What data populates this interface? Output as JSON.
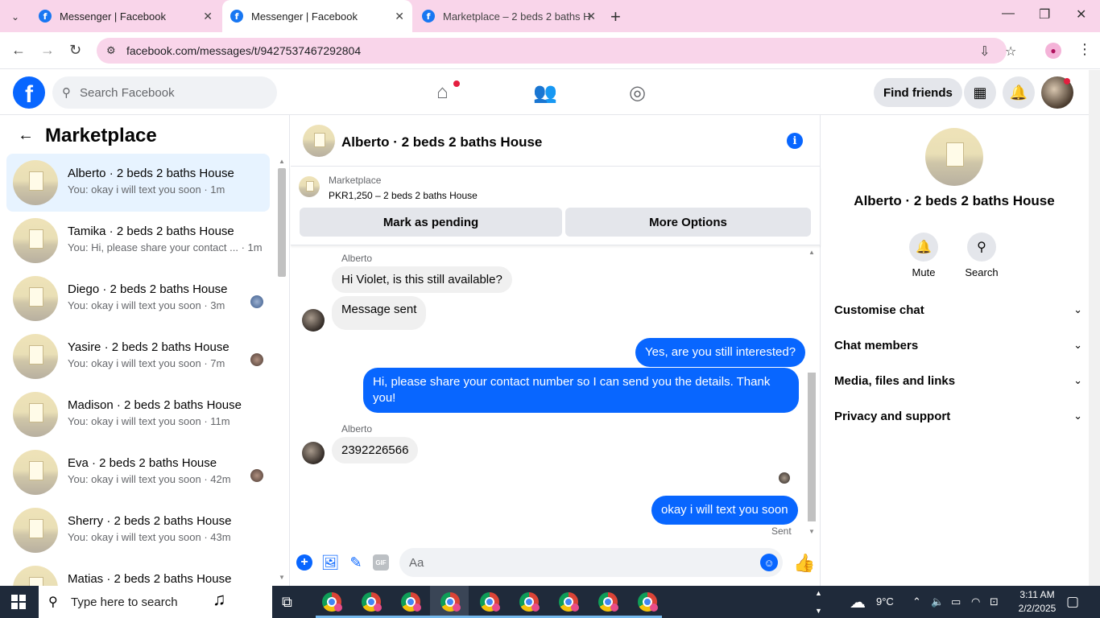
{
  "browser": {
    "tabs": [
      {
        "title": "Messenger | Facebook"
      },
      {
        "title": "Messenger | Facebook"
      },
      {
        "title": "Marketplace – 2 beds 2 baths H"
      }
    ],
    "url": "facebook.com/messages/t/9427537467292804"
  },
  "fb": {
    "search_placeholder": "Search Facebook",
    "find_friends": "Find friends"
  },
  "sidebar": {
    "title": "Marketplace",
    "conversations": [
      {
        "name": "Alberto · 2 beds 2 baths House",
        "preview": "You: okay i will text you soon · 1m"
      },
      {
        "name": "Tamika · 2 beds 2 baths House",
        "preview": "You: Hi, please share your contact ... · 1m"
      },
      {
        "name": "Diego · 2 beds 2 baths House",
        "preview": "You: okay i will text you soon · 3m"
      },
      {
        "name": "Yasire · 2 beds 2 baths House",
        "preview": "You: okay i will text you soon · 7m"
      },
      {
        "name": "Madison · 2 beds 2 baths House",
        "preview": "You: okay i will text you soon · 11m"
      },
      {
        "name": "Eva · 2 beds 2 baths House",
        "preview": "You: okay i will text you soon · 42m"
      },
      {
        "name": "Sherry · 2 beds 2 baths House",
        "preview": "You: okay i will text you soon · 43m"
      },
      {
        "name": "Matias · 2 beds 2 baths House",
        "preview": ""
      }
    ]
  },
  "chat": {
    "title": "Alberto · 2 beds 2 baths House",
    "listing": {
      "label": "Marketplace",
      "price_title": "PKR1,250 – 2 beds 2 baths House",
      "mark_pending": "Mark as pending",
      "more_options": "More Options"
    },
    "messages": {
      "sender1": "Alberto",
      "in1": "Hi Violet, is this still available?",
      "in2": "Message sent",
      "out1": "Yes, are you still interested?",
      "out2": "Hi, please share your contact number so I can send you the details. Thank you!",
      "sender2": "Alberto",
      "in3": "2392226566",
      "out3": "okay i will text you soon",
      "status": "Sent"
    },
    "composer_placeholder": "Aa",
    "gif_label": "GIF"
  },
  "info_panel": {
    "name": "Alberto · 2 beds 2 baths House",
    "actions": [
      {
        "label": "Mute"
      },
      {
        "label": "Search"
      }
    ],
    "sections": [
      {
        "label": "Customise chat"
      },
      {
        "label": "Chat members"
      },
      {
        "label": "Media, files and links"
      },
      {
        "label": "Privacy and support"
      }
    ]
  },
  "taskbar": {
    "search_placeholder": "Type here to search",
    "weather": "9°C",
    "time": "3:11 AM",
    "date": "2/2/2025"
  },
  "colors": {
    "accent": "#0866ff",
    "tab_strip": "#f9d5ea",
    "active_conv": "#e7f3ff"
  }
}
